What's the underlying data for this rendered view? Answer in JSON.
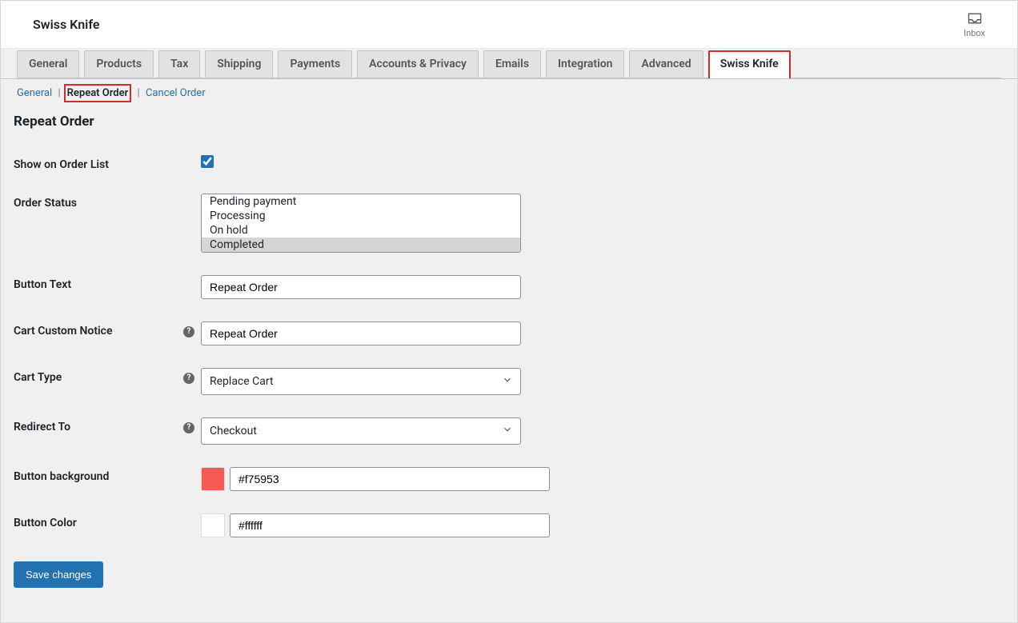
{
  "header": {
    "title": "Swiss Knife",
    "inbox_label": "Inbox"
  },
  "tabs": [
    {
      "label": "General",
      "active": false
    },
    {
      "label": "Products",
      "active": false
    },
    {
      "label": "Tax",
      "active": false
    },
    {
      "label": "Shipping",
      "active": false
    },
    {
      "label": "Payments",
      "active": false
    },
    {
      "label": "Accounts & Privacy",
      "active": false
    },
    {
      "label": "Emails",
      "active": false
    },
    {
      "label": "Integration",
      "active": false
    },
    {
      "label": "Advanced",
      "active": false
    },
    {
      "label": "Swiss Knife",
      "active": true
    }
  ],
  "subnav": {
    "items": [
      {
        "label": "General",
        "link": true,
        "active": false
      },
      {
        "label": "Repeat Order",
        "link": false,
        "active": true
      },
      {
        "label": "Cancel Order",
        "link": true,
        "active": false
      }
    ]
  },
  "section": {
    "heading": "Repeat Order"
  },
  "form": {
    "show_on_order_list": {
      "label": "Show on Order List",
      "checked": true
    },
    "order_status": {
      "label": "Order Status",
      "options": [
        {
          "label": "Pending payment",
          "selected": false
        },
        {
          "label": "Processing",
          "selected": false
        },
        {
          "label": "On hold",
          "selected": false
        },
        {
          "label": "Completed",
          "selected": true
        }
      ]
    },
    "button_text": {
      "label": "Button Text",
      "value": "Repeat Order"
    },
    "cart_notice": {
      "label": "Cart Custom Notice",
      "value": "Repeat Order",
      "help": true
    },
    "cart_type": {
      "label": "Cart Type",
      "value": "Replace Cart",
      "help": true
    },
    "redirect_to": {
      "label": "Redirect To",
      "value": "Checkout",
      "help": true
    },
    "button_bg": {
      "label": "Button background",
      "value": "#f75953",
      "swatch": "#f75953"
    },
    "button_color": {
      "label": "Button Color",
      "value": "#ffffff",
      "swatch": "#ffffff"
    }
  },
  "actions": {
    "save": "Save changes"
  }
}
